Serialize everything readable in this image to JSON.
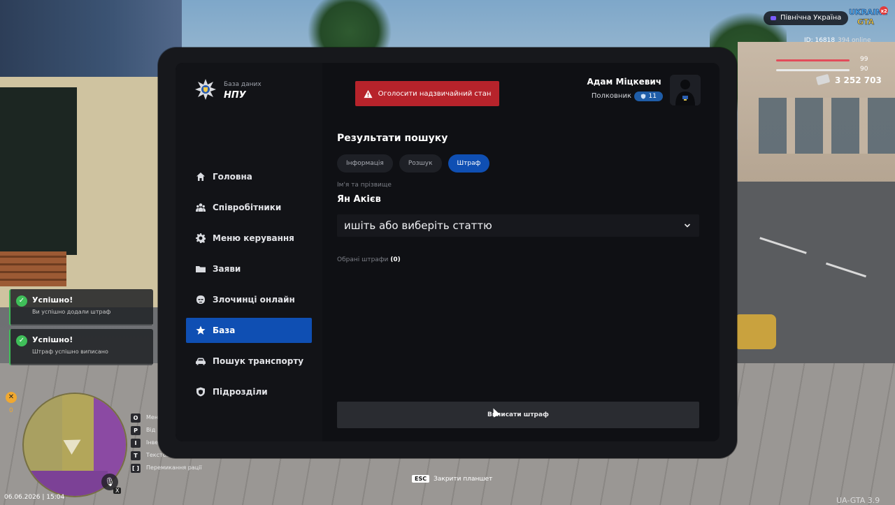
{
  "hud": {
    "region": "Північна Україна",
    "logo_text": "UKRAINE GTA",
    "logo_badge": "x2",
    "player_id": "ID: 16818",
    "online": "394 online",
    "health": "99",
    "armor": "90",
    "money": "3 252 703",
    "datetime": "06.06.2026 | 15:04",
    "version": "UA-GTA 3.9",
    "minimap_counter": "0",
    "mic_key": "X",
    "esc_key": "ESC",
    "esc_label": "Закрити планшет",
    "keybinds": [
      {
        "key": "O",
        "label": "Мен"
      },
      {
        "key": "P",
        "label": "Від"
      },
      {
        "key": "I",
        "label": "Інвен"
      },
      {
        "key": "T",
        "label": "Текстовий чат"
      },
      {
        "key": "[ ]",
        "label": "Перемикання рації"
      }
    ]
  },
  "notifications": [
    {
      "title": "Успішно!",
      "text": "Ви успішно додали штраф"
    },
    {
      "title": "Успішно!",
      "text": "Штраф успішно виписано"
    }
  ],
  "tablet": {
    "brand": {
      "subtitle": "База даних",
      "title": "НПУ"
    },
    "nav": [
      {
        "label": "Головна",
        "icon": "home-icon",
        "active": false
      },
      {
        "label": "Співробітники",
        "icon": "users-icon",
        "active": false
      },
      {
        "label": "Меню керування",
        "icon": "gear-icon",
        "active": false
      },
      {
        "label": "Заяви",
        "icon": "folder-icon",
        "active": false
      },
      {
        "label": "Злочинці онлайн",
        "icon": "mask-icon",
        "active": false
      },
      {
        "label": "База",
        "icon": "star-icon",
        "active": true
      },
      {
        "label": "Пошук транспорту",
        "icon": "car-icon",
        "active": false
      },
      {
        "label": "Підрозділи",
        "icon": "shield-icon",
        "active": false
      }
    ],
    "emergency_button": "Оголосити надзвичайний стан",
    "user": {
      "name": "Адам Міцкевич",
      "rank": "Полковник",
      "level": "11"
    },
    "content": {
      "title": "Результати пошуку",
      "tabs": [
        {
          "label": "Інформація",
          "active": false
        },
        {
          "label": "Розшук",
          "active": false
        },
        {
          "label": "Штраф",
          "active": true
        }
      ],
      "name_label": "Ім'я та прізвище",
      "name_value": "Ян Акієв",
      "article_select": "ишіть або виберіть статтю",
      "selected_fines_label": "Обрані штрафи",
      "selected_fines_count": "(0)",
      "submit_button": "Виписати штраф"
    }
  },
  "colors": {
    "accent": "#0f4fb3",
    "danger": "#b7232b",
    "success": "#3fbf59",
    "tablet_bg": "#0f1014"
  }
}
